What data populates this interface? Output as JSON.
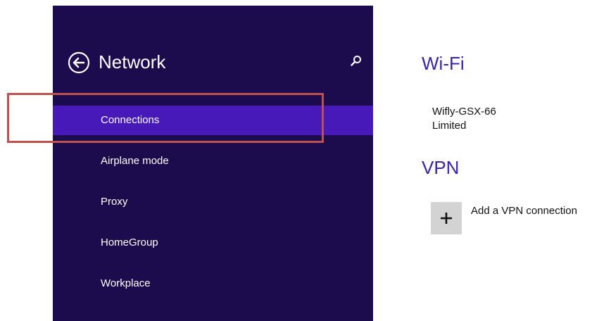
{
  "nav": {
    "title": "Network",
    "back_icon": "back-arrow-circle-icon",
    "search_icon": "search-icon",
    "items": [
      {
        "label": "Connections",
        "selected": true
      },
      {
        "label": "Airplane mode",
        "selected": false
      },
      {
        "label": "Proxy",
        "selected": false
      },
      {
        "label": "HomeGroup",
        "selected": false
      },
      {
        "label": "Workplace",
        "selected": false
      }
    ]
  },
  "content": {
    "wifi": {
      "heading": "Wi-Fi",
      "network": {
        "name": "Wifly-GSX-66",
        "status": "Limited"
      }
    },
    "vpn": {
      "heading": "VPN",
      "add_label": "Add a VPN connection",
      "add_icon": "plus-icon"
    }
  },
  "colors": {
    "nav_background": "#1d0c4d",
    "selected_item": "#4619b8",
    "accent_text": "#3a24a8",
    "highlight_border": "#c0504d",
    "add_tile": "#d3d3d3"
  }
}
